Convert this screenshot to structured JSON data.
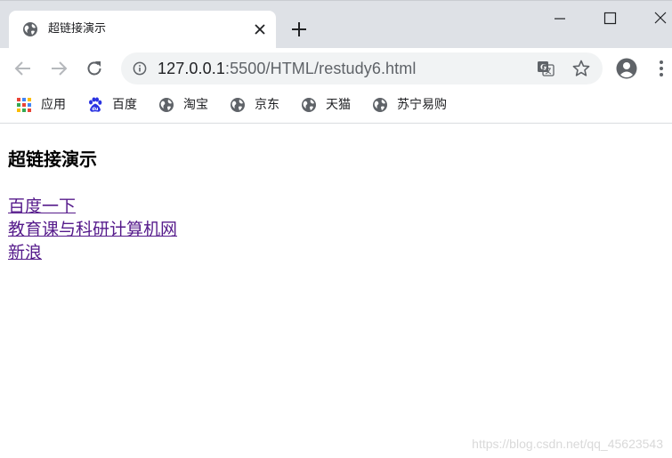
{
  "tab": {
    "title": "超链接演示",
    "close_glyph": "✕"
  },
  "address_bar": {
    "url_host": "127.0.0.1",
    "url_rest": ":5500/HTML/restudy6.html"
  },
  "bookmarks": [
    {
      "label": "应用",
      "icon": "apps-grid-icon"
    },
    {
      "label": "百度",
      "icon": "baidu-paw-icon"
    },
    {
      "label": "淘宝",
      "icon": "globe-icon"
    },
    {
      "label": "京东",
      "icon": "globe-icon"
    },
    {
      "label": "天猫",
      "icon": "globe-icon"
    },
    {
      "label": "苏宁易购",
      "icon": "globe-icon"
    }
  ],
  "page": {
    "heading": "超链接演示",
    "links": [
      {
        "text": "百度一下"
      },
      {
        "text": "教育课与科研计算机网"
      },
      {
        "text": "新浪"
      }
    ]
  },
  "watermark": "https://blog.csdn.net/qq_45623543",
  "colors": {
    "tabstrip_bg": "#dee1e6",
    "omnibox_bg": "#f1f3f4",
    "visited_link": "#551a8b",
    "icon_gray": "#5f6368"
  }
}
